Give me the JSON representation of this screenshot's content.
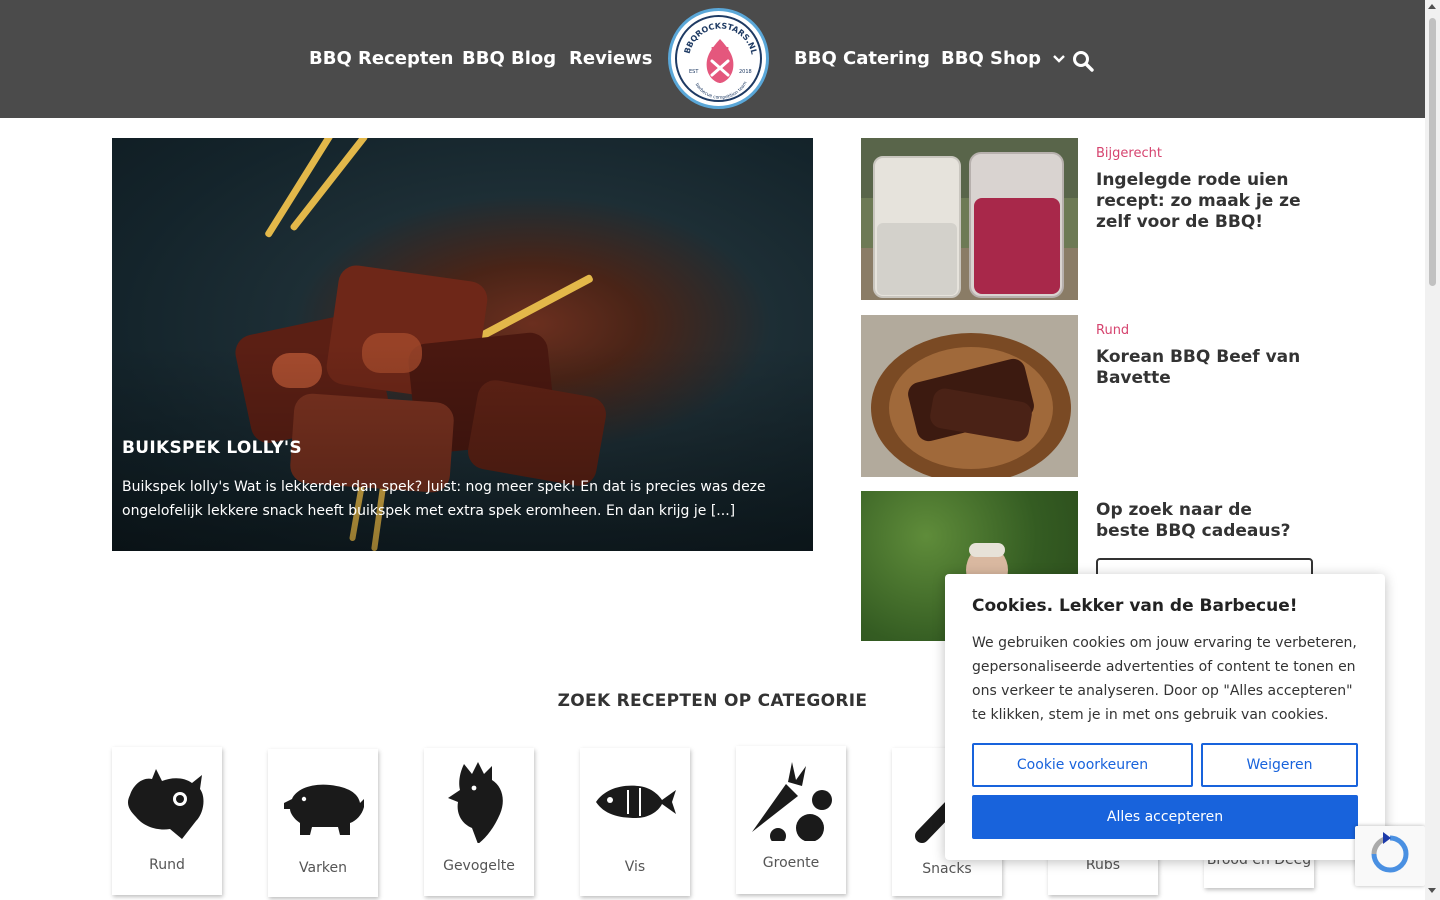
{
  "header": {
    "nav_left": [
      "BBQ Recepten",
      "BBQ Blog",
      "Reviews"
    ],
    "nav_right": [
      "BBQ Catering",
      "BBQ Shop"
    ],
    "logo": {
      "ring_text": "BBQROCKSTARS.NL",
      "est": "EST",
      "year": "2018",
      "tagline": "barbecue competition team"
    }
  },
  "hero": {
    "title": "BUIKSPEK LOLLY'S",
    "excerpt": "Buikspek lolly's Wat is lekkerder dan spek? Juist: nog meer spek! En dat is precies was deze ongelofelijk lekkere snack heeft buikspek met extra spek eromheen. En dan krijg je [...]"
  },
  "cards": [
    {
      "category": "Bijgerecht",
      "title": "Ingelegde rode uien recept: zo maak je ze zelf voor de BBQ!"
    },
    {
      "category": "Rund",
      "title": "Korean BBQ Beef van Bavette"
    },
    {
      "category": "",
      "title": "Op zoek naar de beste BBQ cadeaus?"
    }
  ],
  "categories": {
    "heading": "ZOEK RECEPTEN OP CATEGORIE",
    "items": [
      "Rund",
      "Varken",
      "Gevogelte",
      "Vis",
      "Groente",
      "Snacks",
      "Rubs",
      "Brood en Deeg"
    ]
  },
  "cookie": {
    "title": "Cookies. Lekker van de Barbecue!",
    "text": "We gebruiken cookies om jouw ervaring te verbeteren, gepersonaliseerde advertenties of content te tonen en ons verkeer te analyseren. Door op \"Alles accepteren\" te klikken, stem je in met ons gebruik van cookies.",
    "preferences": "Cookie voorkeuren",
    "reject": "Weigeren",
    "accept": "Alles accepteren"
  },
  "colors": {
    "header_bg": "#4b4b4b",
    "accent_pink": "#d6446f",
    "cookie_blue": "#1863dc"
  }
}
